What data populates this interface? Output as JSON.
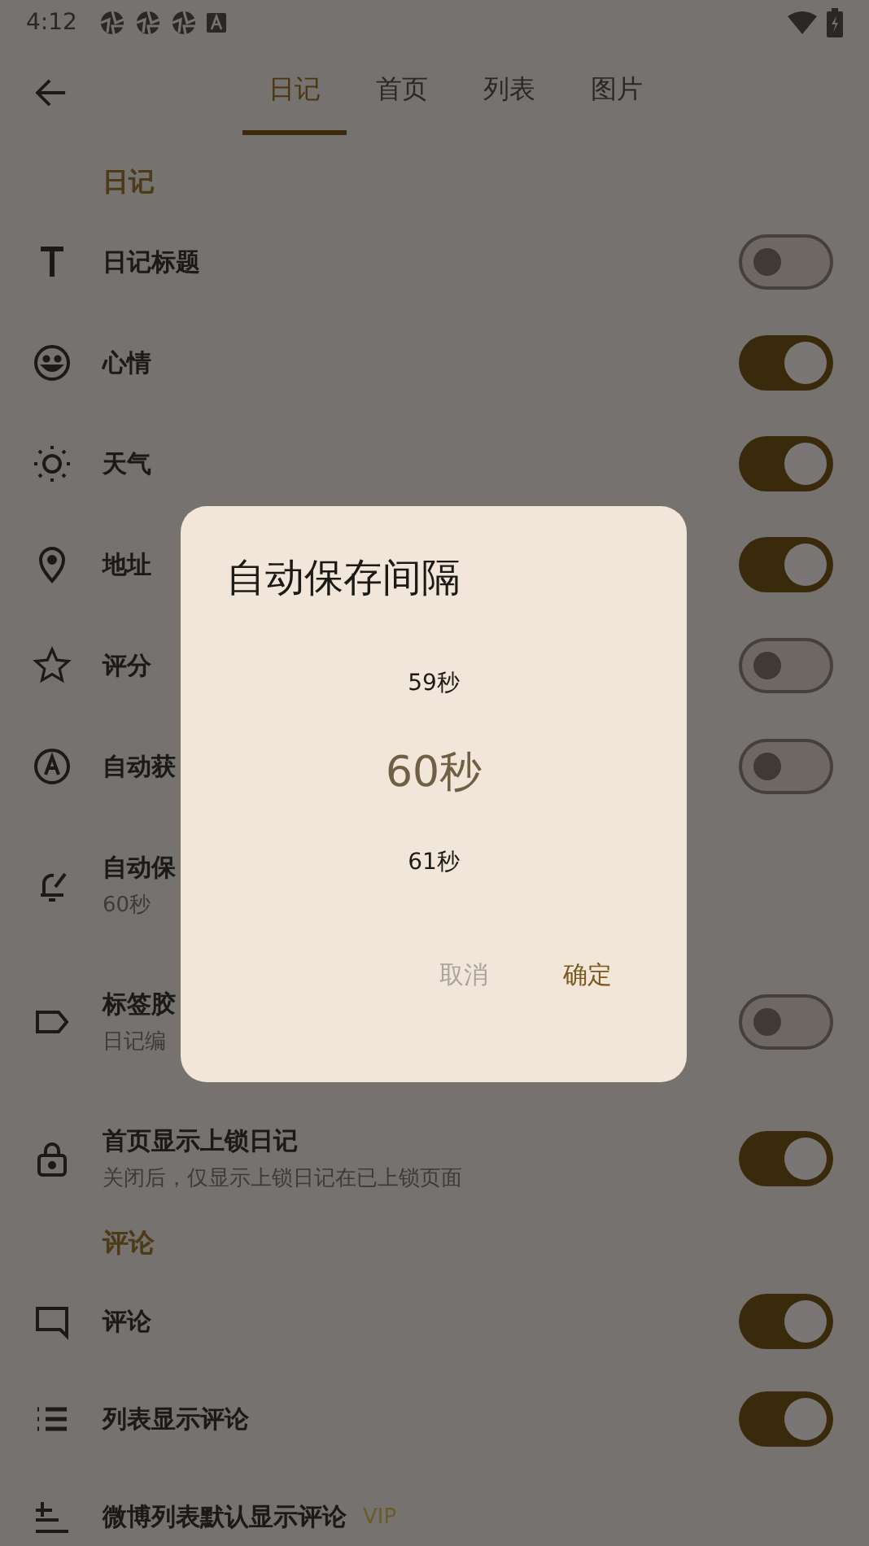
{
  "status_bar": {
    "time": "4:12"
  },
  "tabs": [
    {
      "label": "日记",
      "selected": true
    },
    {
      "label": "首页",
      "selected": false
    },
    {
      "label": "列表",
      "selected": false
    },
    {
      "label": "图片",
      "selected": false
    }
  ],
  "sections": [
    {
      "title": "日记",
      "items": [
        {
          "kind": "title",
          "title": "日记标题",
          "on": false
        },
        {
          "kind": "mood",
          "title": "心情",
          "on": true
        },
        {
          "kind": "weather",
          "title": "天气",
          "on": true
        },
        {
          "kind": "location",
          "title": "地址",
          "on": true
        },
        {
          "kind": "rating",
          "title": "评分",
          "on": false
        },
        {
          "kind": "auto",
          "title": "自动获",
          "on": false
        },
        {
          "kind": "alarm",
          "title": "自动保",
          "subtitle": "60秒"
        },
        {
          "kind": "tag",
          "title": "标签胶",
          "subtitle": "日记编",
          "on": false
        },
        {
          "kind": "lock",
          "title": "首页显示上锁日记",
          "subtitle": "关闭后，仅显示上锁日记在已上锁页面",
          "on": true
        }
      ]
    },
    {
      "title": "评论",
      "items": [
        {
          "kind": "comment",
          "title": "评论",
          "on": true
        },
        {
          "kind": "list",
          "title": "列表显示评论",
          "on": true
        },
        {
          "kind": "sort",
          "title": "微博列表默认显示评论",
          "badge": "VIP"
        }
      ]
    }
  ],
  "dialog": {
    "title": "自动保存间隔",
    "options": [
      {
        "label": "59秒",
        "selected": false
      },
      {
        "label": "60秒",
        "selected": true
      },
      {
        "label": "61秒",
        "selected": false
      }
    ],
    "buttons": [
      {
        "label": "取消",
        "kind": "cancel"
      },
      {
        "label": "确定",
        "kind": "confirm"
      }
    ]
  }
}
